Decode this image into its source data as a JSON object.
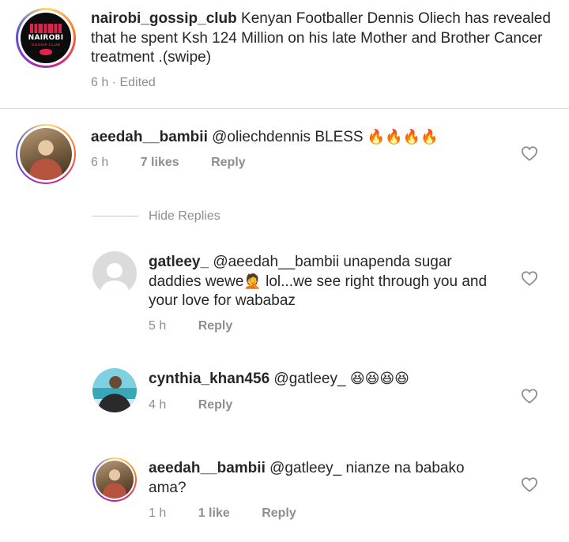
{
  "caption": {
    "username": "nairobi_gossip_club",
    "text": "Kenyan Footballer Dennis Oliech has revealed that he spent Ksh 124 Million on his late Mother and Brother Cancer treatment .(swipe)",
    "meta": "6 h · Edited",
    "logo": {
      "brand": "NAIROBI",
      "sub": "GOSSIP CLUB"
    }
  },
  "comments": [
    {
      "username": "aeedah__bambii",
      "text": "@oliechdennis BLESS",
      "emoji": "🔥🔥🔥🔥",
      "time": "6 h",
      "likes": "7 likes",
      "reply": "Reply"
    },
    {
      "username": "gatleey_",
      "text": "@aeedah__bambii unapenda sugar daddies wewe",
      "emoji": "🤦",
      "text2": "lol...we see right through you and your love for wababaz",
      "time": "5 h",
      "reply": "Reply"
    },
    {
      "username": "cynthia_khan456",
      "text": "@gatleey_",
      "emoji": "😆😆😆😆",
      "time": "4 h",
      "reply": "Reply"
    },
    {
      "username": "aeedah__bambii",
      "text": "@gatleey_ nianze na babako ama?",
      "time": "1 h",
      "likes": "1 like",
      "reply": "Reply"
    }
  ],
  "hide_replies": "Hide Replies",
  "icons": {
    "like": "heart-outline-icon",
    "default_avatar": "default-user-icon"
  },
  "colors": {
    "meta_grey": "#8e8e8e",
    "text": "#262626",
    "divider": "#dbdbdb",
    "logo_accent": "#e0234e"
  }
}
